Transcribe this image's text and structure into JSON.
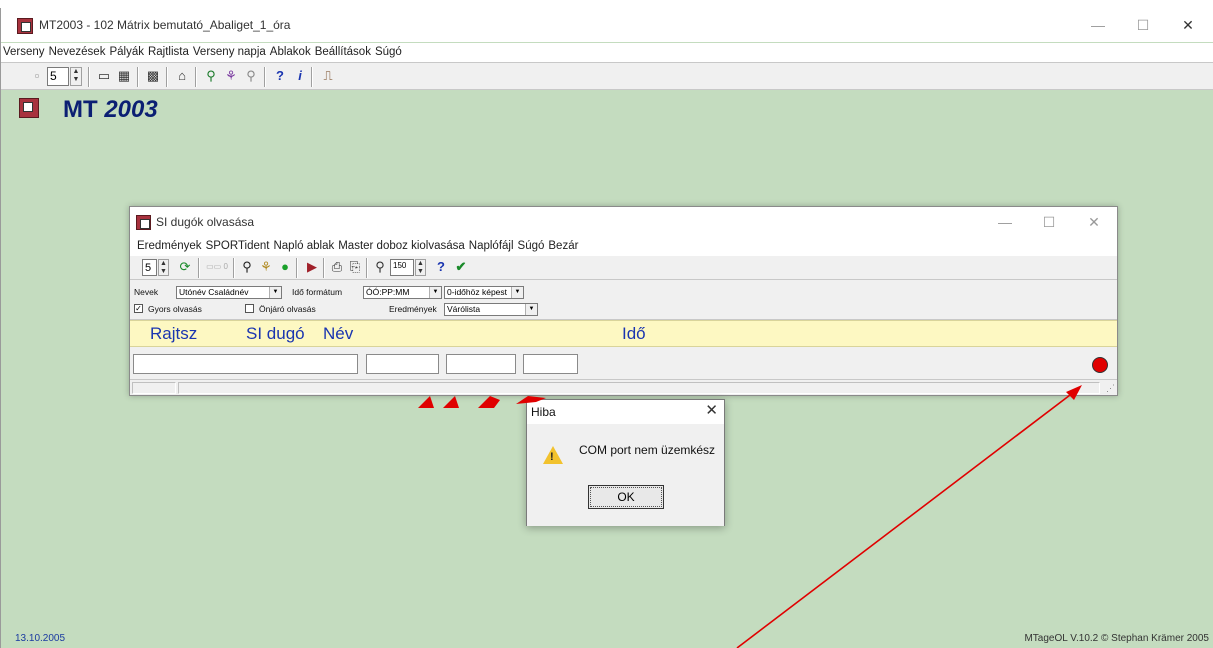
{
  "window": {
    "title": "MT2003  -  102 Mátrix bemutató_Abaliget_1_óra",
    "controls": {
      "minimize": "—",
      "maximize": "☐",
      "close": "✕"
    }
  },
  "menu": [
    "Verseny",
    "Nevezések",
    "Pályák",
    "Rajtlista",
    "Verseny napja",
    "Ablakok",
    "Beállítások",
    "Súgó"
  ],
  "toolbar": {
    "spin_value": "5"
  },
  "logo": {
    "name": "MT",
    "year": "2003"
  },
  "status": {
    "date": "13.10.2005",
    "copyright": "MTageOL V.10.2 © Stephan Krämer 2005"
  },
  "si_window": {
    "title": "SI dugók olvasása",
    "controls": {
      "minimize": "—",
      "maximize": "☐",
      "close": "✕"
    },
    "menu": [
      "Eredmények",
      "SPORTident",
      "Napló ablak",
      "Master doboz kiolvasása",
      "Naplófájl",
      "Súgó",
      "Bezár"
    ],
    "toolbar": {
      "spin_value": "5",
      "counter": "0",
      "speed_value": "150"
    },
    "options": {
      "names_label": "Nevek",
      "names_value": "Utónév Családnév",
      "time_format_label": "Idő formátum",
      "time_format_value": "ÓÓ:PP:MM",
      "time_ref_value": "0-időhöz képest",
      "fast_read_label": "Gyors olvasás",
      "fast_read_checked": true,
      "auto_read_label": "Önjáró olvasás",
      "auto_read_checked": false,
      "results_label": "Eredmények",
      "results_value": "Várólista"
    },
    "columns": {
      "start_no": "Rajtsz",
      "si_card": "SI dugó",
      "name": "Név",
      "time": "Idő"
    },
    "indicator_color": "#e00000"
  },
  "dialog": {
    "title": "Hiba",
    "close": "✕",
    "message": "COM port nem üzemkész",
    "ok_label": "OK",
    "icon": "warning-icon"
  },
  "colors": {
    "desktop": "#c4dcbf",
    "logo": "#0b1f73",
    "header_band": "#fdf8c2",
    "column_text": "#1a35b0",
    "arrow": "#e00000"
  }
}
